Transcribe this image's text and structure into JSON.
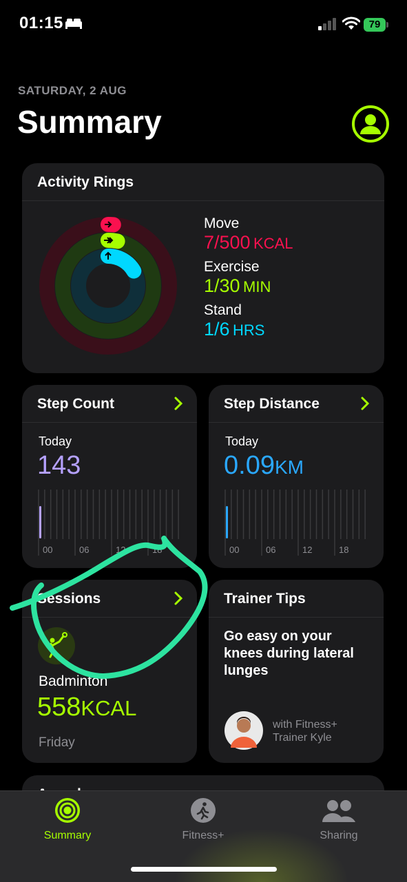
{
  "status": {
    "time": "01:15",
    "battery": "79"
  },
  "header": {
    "date": "SATURDAY, 2 AUG",
    "title": "Summary"
  },
  "activity": {
    "title": "Activity Rings",
    "move": {
      "label": "Move",
      "value": "7/500",
      "unit": "KCAL",
      "progress": 0.014,
      "color": "#fa114f"
    },
    "exercise": {
      "label": "Exercise",
      "value": "1/30",
      "unit": "MIN",
      "progress": 0.033,
      "color": "#a6ff00"
    },
    "stand": {
      "label": "Stand",
      "value": "1/6",
      "unit": "HRS",
      "progress": 0.167,
      "color": "#00d8ff"
    }
  },
  "step_count": {
    "title": "Step Count",
    "today_label": "Today",
    "value": "143",
    "color": "#b5a1ff",
    "ticks": [
      "00",
      "06",
      "12",
      "18"
    ]
  },
  "step_distance": {
    "title": "Step Distance",
    "today_label": "Today",
    "value": "0.09",
    "unit": "KM",
    "color": "#2aa8ff",
    "ticks": [
      "00",
      "06",
      "12",
      "18"
    ]
  },
  "sessions": {
    "title": "Sessions",
    "activity": "Badminton",
    "value": "558",
    "unit": "KCAL",
    "day": "Friday"
  },
  "trainer_tips": {
    "title": "Trainer Tips",
    "tip": "Go easy on your knees during lateral lunges",
    "credit_line1": "with Fitness+",
    "credit_line2": "Trainer Kyle"
  },
  "awards": {
    "title": "Awards"
  },
  "tabs": [
    {
      "label": "Summary",
      "active": true
    },
    {
      "label": "Fitness+",
      "active": false
    },
    {
      "label": "Sharing",
      "active": false
    }
  ],
  "colors": {
    "accent": "#a6ff00",
    "annotation": "#2de3a0"
  }
}
